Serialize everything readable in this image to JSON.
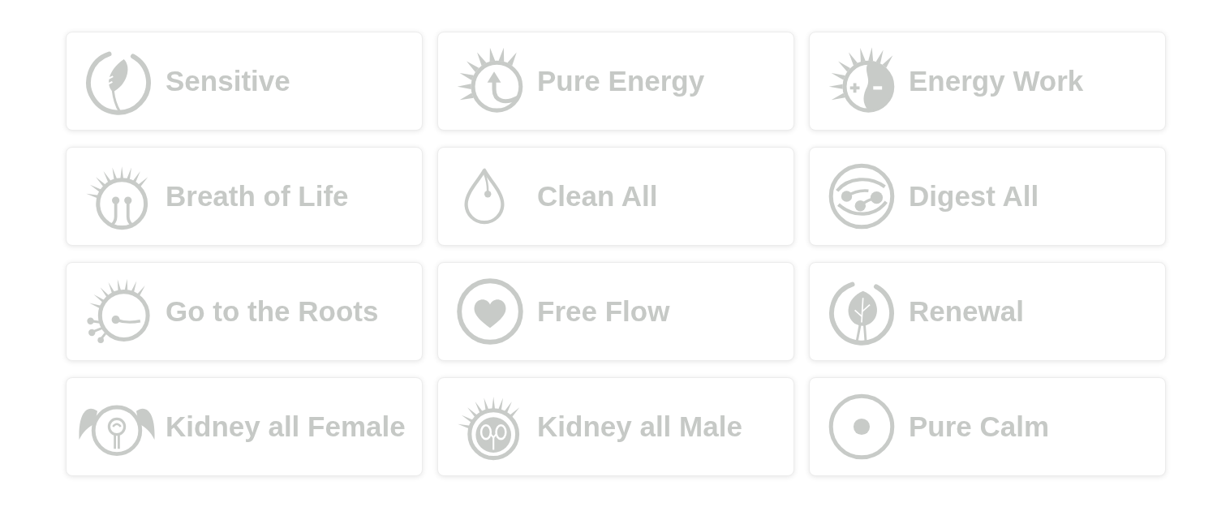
{
  "items": [
    {
      "label": "Sensitive",
      "kind": "feather",
      "selected": false
    },
    {
      "label": "Pure Energy",
      "kind": "sunrise",
      "selected": false
    },
    {
      "label": "Energy Work",
      "kind": "polarity",
      "selected": false
    },
    {
      "label": "Breath of Life",
      "kind": "breath",
      "selected": false
    },
    {
      "label": "Clean All",
      "kind": "drop",
      "selected": false
    },
    {
      "label": "Digest All",
      "kind": "digest",
      "selected": false
    },
    {
      "label": "Go to the Roots",
      "kind": "roots",
      "selected": false
    },
    {
      "label": "Free Flow",
      "kind": "heart",
      "selected": false
    },
    {
      "label": "Renewal",
      "kind": "leaf",
      "selected": false
    },
    {
      "label": "Kidney all Female",
      "kind": "pigtails",
      "selected": false
    },
    {
      "label": "Kidney all Male",
      "kind": "kidney",
      "selected": false
    },
    {
      "label": "Pure Calm",
      "kind": "dot",
      "selected": false
    }
  ]
}
